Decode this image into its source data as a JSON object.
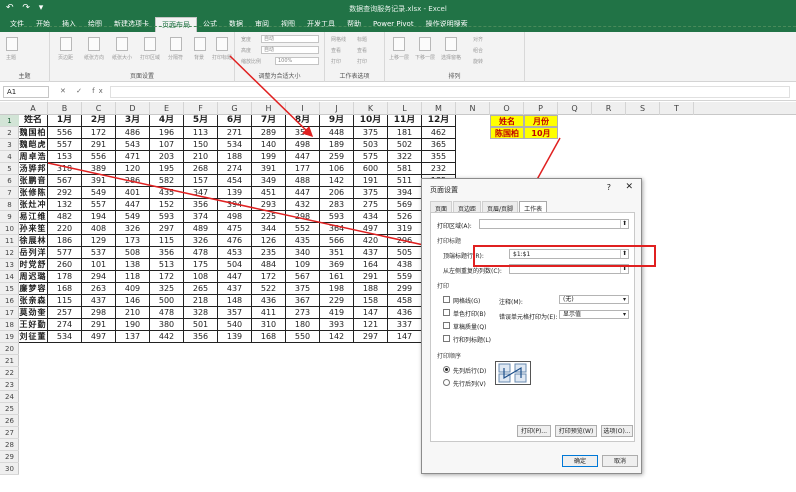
{
  "app": {
    "title": "数据查询服务记录.xlsx - Excel",
    "quick_access": "↶ ↷ ▾"
  },
  "ribbon_tabs": [
    "文件",
    "开始",
    "插入",
    "绘图",
    "新建选项卡",
    "页面布局",
    "公式",
    "数据",
    "审阅",
    "视图",
    "开发工具",
    "帮助",
    "Power Pivot",
    "操作说明搜索"
  ],
  "active_tab": 5,
  "ribbon_groups": [
    {
      "label": "主题"
    },
    {
      "label": "页面设置"
    },
    {
      "label": "调整为合适大小"
    },
    {
      "label": "工作表选项"
    },
    {
      "label": "排列"
    }
  ],
  "ribbon_items": {
    "theme": "主题",
    "margins": "页边距",
    "orientation": "纸张方向",
    "size": "纸张大小",
    "print_area": "打印区域",
    "breaks": "分隔符",
    "background": "背景",
    "print_titles": "打印标题",
    "width": "宽度",
    "width_val": "自动",
    "height": "高度",
    "height_val": "自动",
    "scale": "缩放比例",
    "scale_val": "100%",
    "gridlines": "网格线",
    "headings": "标题",
    "view": "查看",
    "print": "打印",
    "bring_forward": "上移一层",
    "send_backward": "下移一层",
    "selection_pane": "选择窗格",
    "align": "对齐",
    "group": "组合",
    "rotate": "旋转"
  },
  "formula_bar": {
    "name_box": "A1",
    "fx": "✕ ✓ fx",
    "value": ""
  },
  "columns": [
    "A",
    "B",
    "C",
    "D",
    "E",
    "F",
    "G",
    "H",
    "I",
    "J",
    "K",
    "L",
    "M",
    "N",
    "O",
    "P",
    "Q",
    "R",
    "S",
    "T"
  ],
  "rows": [
    "1",
    "2",
    "3",
    "4",
    "5",
    "6",
    "7",
    "8",
    "9",
    "10",
    "11",
    "12",
    "13",
    "14",
    "15",
    "16",
    "17",
    "18",
    "19",
    "20",
    "21",
    "22",
    "23",
    "24",
    "25",
    "26",
    "27",
    "28",
    "29",
    "30"
  ],
  "table": {
    "headers": [
      "姓名",
      "1月",
      "2月",
      "3月",
      "4月",
      "5月",
      "6月",
      "7月",
      "8月",
      "9月",
      "10月",
      "11月",
      "12月"
    ],
    "rows": [
      [
        "魏国柏",
        "556",
        "172",
        "486",
        "196",
        "113",
        "271",
        "289",
        "353",
        "448",
        "375",
        "181",
        "462"
      ],
      [
        "魏皑虎",
        "557",
        "291",
        "543",
        "107",
        "150",
        "534",
        "140",
        "498",
        "189",
        "503",
        "502",
        "365"
      ],
      [
        "周卓浩",
        "153",
        "556",
        "471",
        "203",
        "210",
        "188",
        "199",
        "447",
        "259",
        "575",
        "322",
        "355"
      ],
      [
        "汤骅邦",
        "318",
        "389",
        "120",
        "195",
        "268",
        "274",
        "391",
        "177",
        "106",
        "600",
        "581",
        "232"
      ],
      [
        "张鹏音",
        "567",
        "391",
        "286",
        "582",
        "157",
        "454",
        "349",
        "488",
        "142",
        "191",
        "511",
        "185"
      ],
      [
        "张修陈",
        "292",
        "549",
        "401",
        "435",
        "347",
        "139",
        "451",
        "447",
        "206",
        "375",
        "394",
        "280"
      ],
      [
        "张灶冲",
        "132",
        "557",
        "447",
        "152",
        "356",
        "394",
        "293",
        "432",
        "283",
        "275",
        "569",
        "448"
      ],
      [
        "易江维",
        "482",
        "194",
        "549",
        "593",
        "374",
        "498",
        "225",
        "298",
        "593",
        "434",
        "526",
        "445"
      ],
      [
        "孙来笙",
        "220",
        "408",
        "326",
        "297",
        "489",
        "475",
        "344",
        "552",
        "364",
        "497",
        "319",
        "391"
      ],
      [
        "徐展林",
        "186",
        "129",
        "173",
        "115",
        "326",
        "476",
        "126",
        "435",
        "566",
        "420",
        "296",
        "396"
      ],
      [
        "岳列洋",
        "577",
        "537",
        "508",
        "356",
        "478",
        "453",
        "235",
        "340",
        "351",
        "437",
        "505",
        "234"
      ],
      [
        "时党舒",
        "260",
        "101",
        "138",
        "513",
        "175",
        "504",
        "484",
        "109",
        "369",
        "164",
        "438",
        "339"
      ],
      [
        "周迟璐",
        "178",
        "294",
        "118",
        "172",
        "108",
        "447",
        "172",
        "567",
        "161",
        "291",
        "559",
        "290"
      ],
      [
        "廉梦容",
        "168",
        "263",
        "409",
        "325",
        "265",
        "437",
        "522",
        "375",
        "198",
        "188",
        "299",
        "596"
      ],
      [
        "张亲森",
        "115",
        "437",
        "146",
        "500",
        "218",
        "148",
        "436",
        "367",
        "229",
        "158",
        "458",
        "354"
      ],
      [
        "莫劲奎",
        "257",
        "298",
        "210",
        "478",
        "328",
        "357",
        "411",
        "273",
        "419",
        "147",
        "436",
        "341"
      ],
      [
        "王好勤",
        "274",
        "291",
        "190",
        "380",
        "501",
        "540",
        "310",
        "180",
        "393",
        "121",
        "337",
        "322"
      ],
      [
        "刘征董",
        "534",
        "497",
        "137",
        "442",
        "356",
        "139",
        "168",
        "550",
        "142",
        "297",
        "147",
        "594"
      ]
    ]
  },
  "side_labels": {
    "name_label": "姓名",
    "month_label": "月份",
    "name_value": "陈国柏",
    "month_value": "10月"
  },
  "dialog": {
    "title": "页面设置",
    "help": "?",
    "close": "✕",
    "tabs": [
      "页面",
      "页边距",
      "页眉/页脚",
      "工作表"
    ],
    "active_tab": 3,
    "print_area_label": "打印区域(A):",
    "print_titles_label": "打印标题",
    "rows_repeat_label": "顶端标题行(R):",
    "rows_repeat_value": "$1:$1",
    "cols_repeat_label": "从左侧重复的列数(C):",
    "print_section": "打印",
    "checks": [
      "网格线(G)",
      "单色打印(B)",
      "草稿质量(Q)",
      "行和列标题(L)"
    ],
    "comments_label": "注释(M):",
    "comments_value": "(无)",
    "errors_label": "错误单元格打印为(E):",
    "errors_value": "显示值",
    "order_section": "打印顺序",
    "order_down": "先列后行(D)",
    "order_over": "先行后列(V)",
    "btn_print": "打印(P)...",
    "btn_preview": "打印预览(W)",
    "btn_options": "选项(O)...",
    "btn_ok": "确定",
    "btn_cancel": "取消"
  },
  "colors": {
    "excel_green": "#217346",
    "highlight": "#ffff00",
    "arrow": "#e02020"
  }
}
